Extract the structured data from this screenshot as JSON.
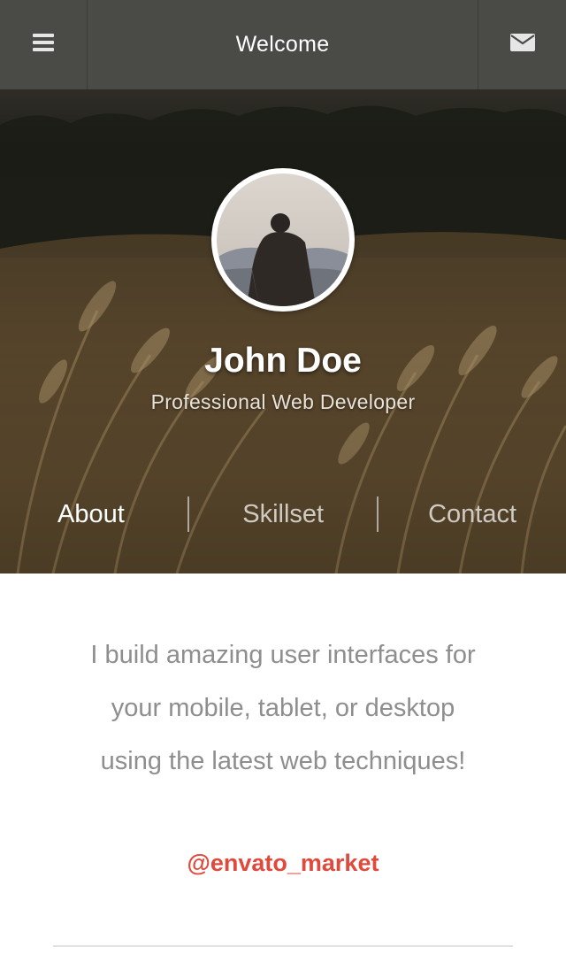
{
  "header": {
    "title": "Welcome",
    "menu_icon": "hamburger-menu-icon",
    "mail_icon": "envelope-icon",
    "bg_color": "#4a4a46"
  },
  "profile": {
    "name": "John Doe",
    "role": "Professional Web Developer"
  },
  "tabs": [
    {
      "label": "About",
      "active": true
    },
    {
      "label": "Skillset",
      "active": false
    },
    {
      "label": "Contact",
      "active": false
    }
  ],
  "about": {
    "bio": "I build amazing user interfaces for your mobile, tablet, or desktop using the latest web techniques!",
    "handle": "@envato_market"
  },
  "colors": {
    "accent": "#e04a3c",
    "bio_text": "#8e8e8e"
  }
}
